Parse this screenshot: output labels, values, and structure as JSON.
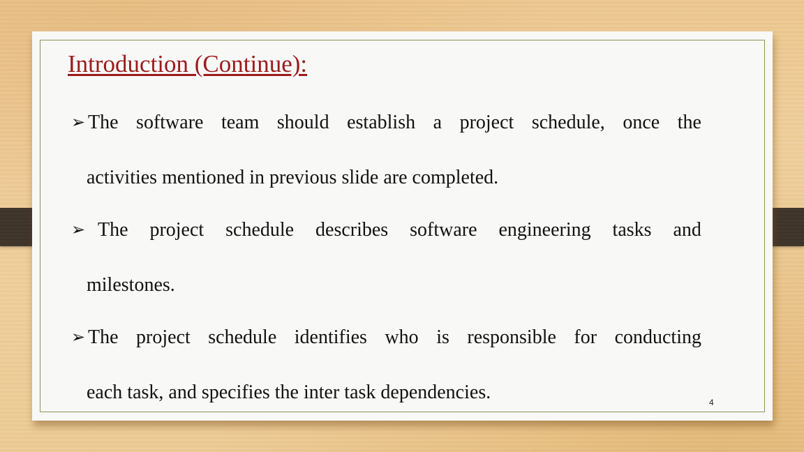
{
  "slide": {
    "title": "Introduction (Continue):",
    "page_number": "4",
    "bullet_icon": "arrowhead-bullet-icon",
    "bullets": [
      {
        "line1_words": [
          "The",
          "software",
          "team",
          "should",
          "establish",
          "a",
          "project",
          "schedule,",
          "once",
          "the"
        ],
        "line2": "activities mentioned in previous slide  are completed."
      },
      {
        "line1_words": [
          "The",
          "project",
          "schedule",
          "describes",
          "software",
          "engineering",
          "tasks",
          "and"
        ],
        "line2": "milestones."
      },
      {
        "line1_words": [
          "The",
          "project",
          "schedule",
          "identifies",
          "who",
          "is",
          "responsible",
          "for",
          "conducting"
        ],
        "line2": "each task, and specifies the inter task dependencies."
      }
    ]
  },
  "colors": {
    "title": "#9b1c1c",
    "frame_border": "#8a9458",
    "tab": "#3f342a",
    "background_wood": "#ecc78f"
  }
}
